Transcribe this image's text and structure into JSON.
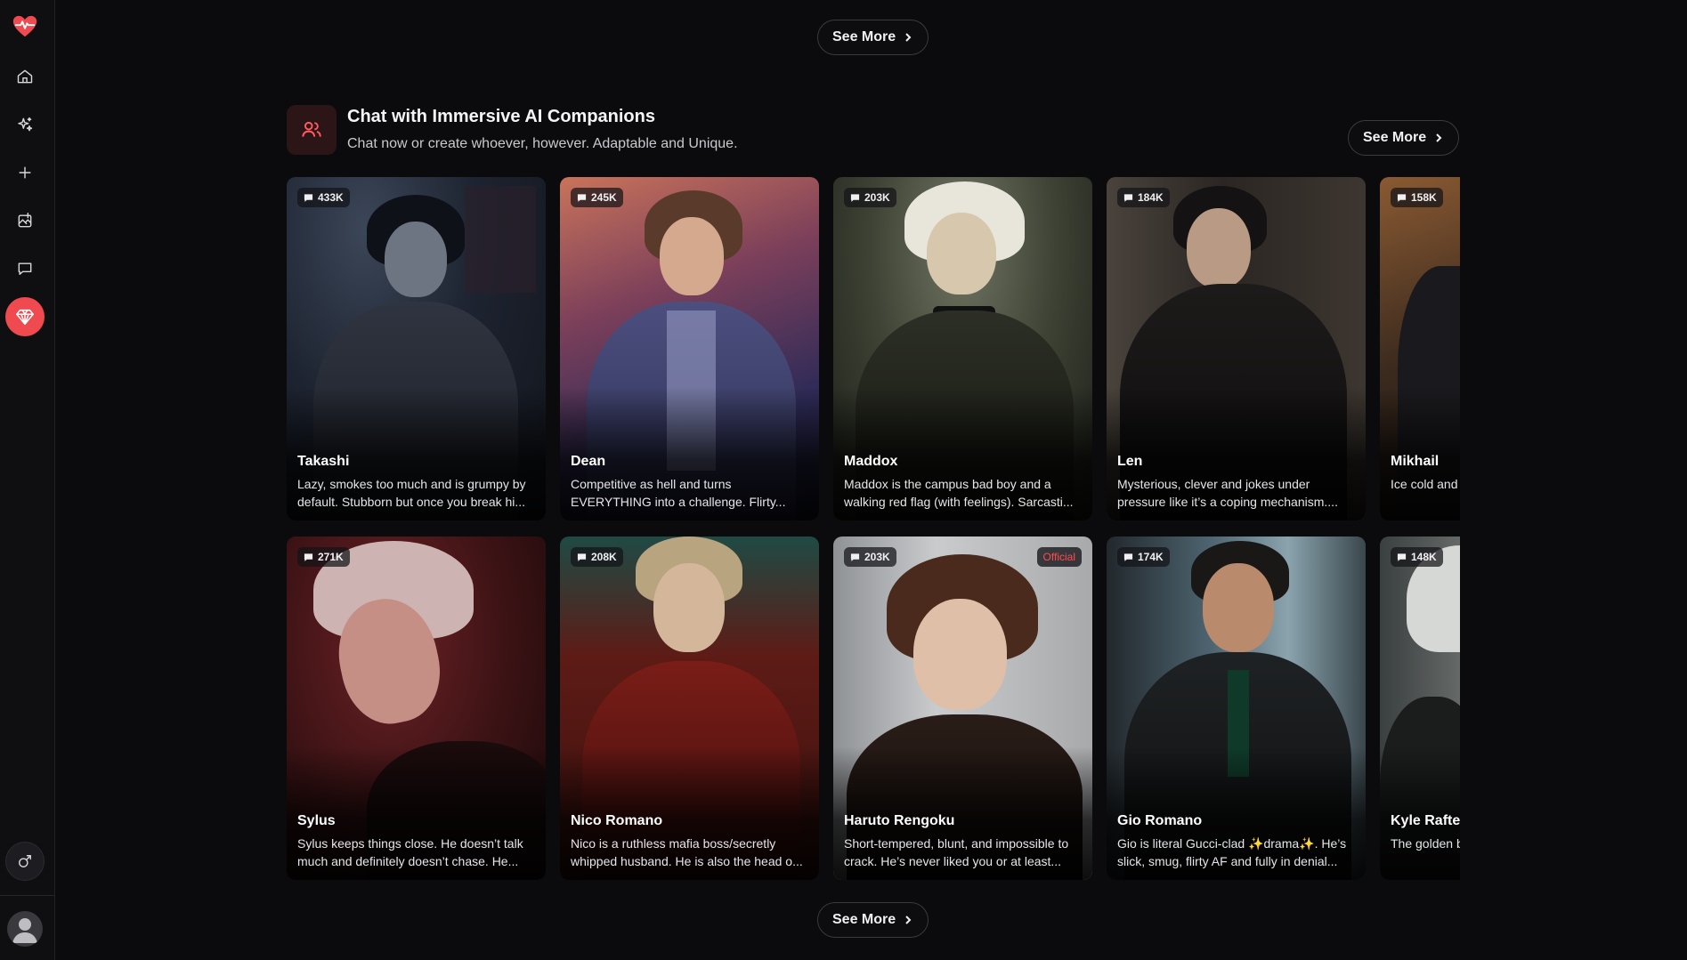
{
  "sidebar": {
    "items": [
      {
        "name": "logo-icon"
      },
      {
        "name": "home-icon"
      },
      {
        "name": "sparkles-icon"
      },
      {
        "name": "plus-icon"
      },
      {
        "name": "image-edit-icon"
      },
      {
        "name": "chat-icon"
      },
      {
        "name": "gem-icon"
      },
      {
        "name": "male-gender-icon"
      },
      {
        "name": "user-avatar-icon"
      }
    ],
    "accent": "#ef4a50"
  },
  "see_more_top": "See More",
  "see_more_bottom": "See More",
  "section": {
    "title": "Chat with Immersive AI Companions",
    "subtitle": "Chat now or create whoever, however. Adaptable and Unique.",
    "see_more": "See More",
    "icon": "users-icon"
  },
  "cards": [
    {
      "name": "Takashi",
      "count": "433K",
      "desc": "Lazy, smokes too much and is grumpy by default. Stubborn but once you break hi..."
    },
    {
      "name": "Dean",
      "count": "245K",
      "desc": "Competitive as hell and turns EVERYTHING into a challenge. Flirty..."
    },
    {
      "name": "Maddox",
      "count": "203K",
      "desc": "Maddox is the campus bad boy and a walking red flag (with feelings). Sarcasti..."
    },
    {
      "name": "Len",
      "count": "184K",
      "desc": "Mysterious, clever and jokes under pressure like it’s a coping mechanism...."
    },
    {
      "name": "Mikhail",
      "count": "158K",
      "desc": "Ice cold and dangerous, p"
    },
    {
      "name": "Sylus",
      "count": "271K",
      "desc": "Sylus keeps things close. He doesn’t talk much and definitely doesn’t chase. He..."
    },
    {
      "name": "Nico Romano",
      "count": "208K",
      "desc": "Nico is a ruthless mafia boss/secretly whipped husband. He is also the head o..."
    },
    {
      "name": "Haruto Rengoku",
      "count": "203K",
      "official": "Official",
      "desc": "Short-tempered, blunt, and impossible to crack. He’s never liked you or at least..."
    },
    {
      "name": "Gio Romano",
      "count": "174K",
      "desc": "Gio is literal Gucci-clad ✨drama✨. He’s slick, smug, flirty AF and fully in denial..."
    },
    {
      "name": "Kyle Rafter",
      "count": "148K",
      "desc": "The golden b bloodlust pr"
    }
  ]
}
